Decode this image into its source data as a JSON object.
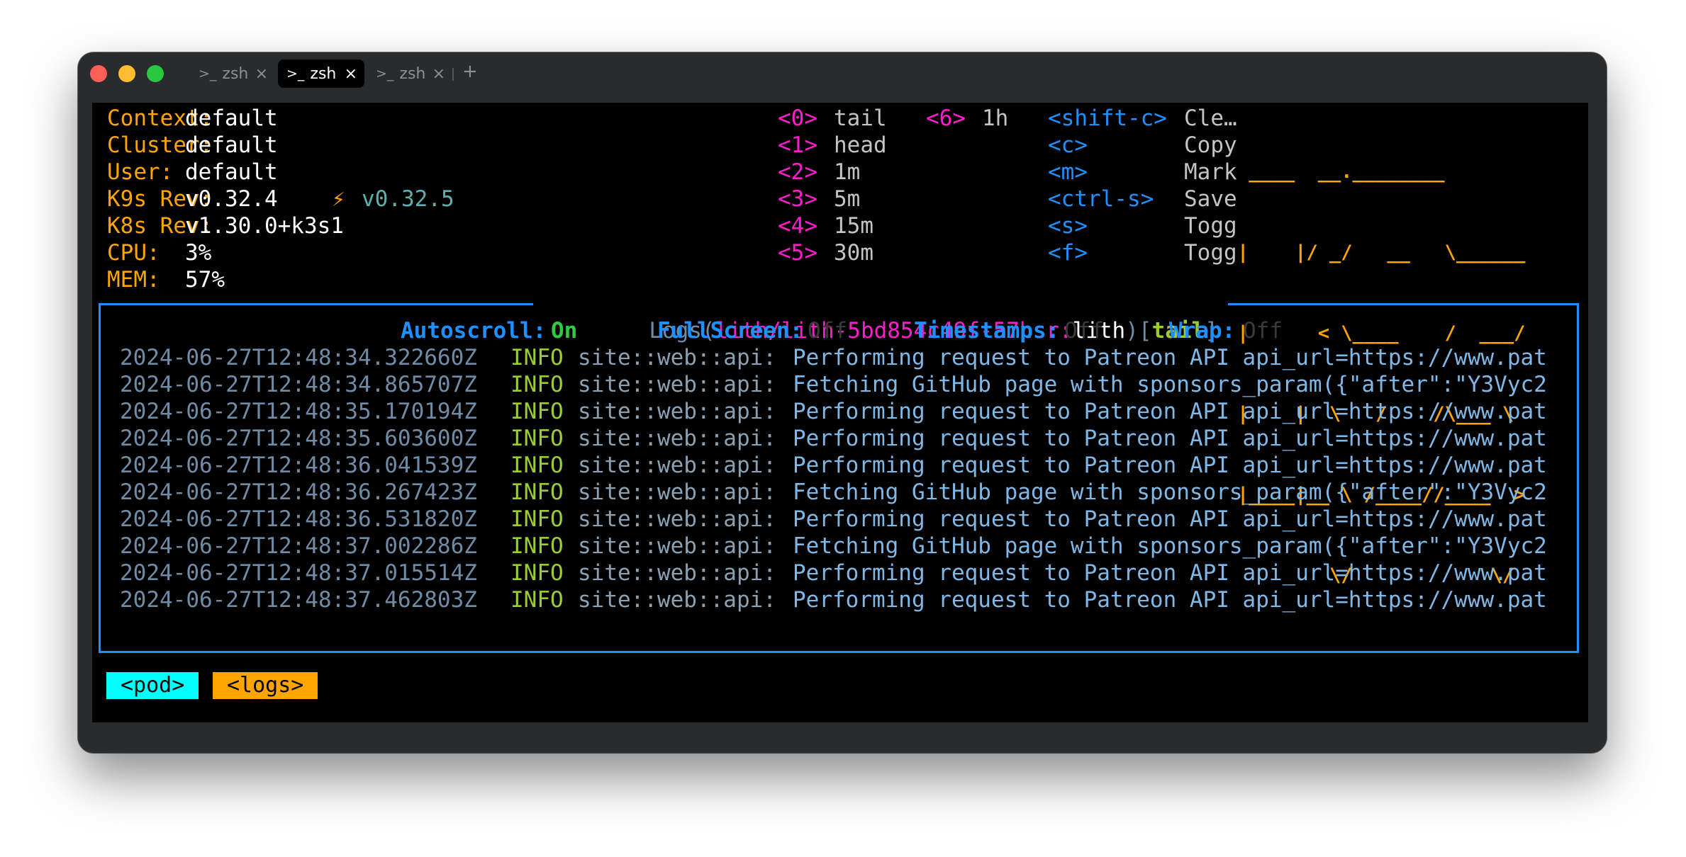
{
  "window": {
    "tabs": [
      {
        "prompt": ">_",
        "label": "zsh",
        "close": "×",
        "active": false
      },
      {
        "prompt": ">_",
        "label": "zsh",
        "close": "×",
        "active": true
      },
      {
        "prompt": ">_",
        "label": "zsh",
        "close": "×",
        "active": false
      }
    ],
    "new_tab": "+"
  },
  "info": [
    {
      "label": "Context:",
      "value": "default"
    },
    {
      "label": "Cluster:",
      "value": "default"
    },
    {
      "label": "User:",
      "value": "default"
    },
    {
      "label": "K9s Rev:",
      "value": "v0.32.4",
      "bolt": "⚡",
      "upgrade": "v0.32.5"
    },
    {
      "label": "K8s Rev:",
      "value": "v1.30.0+k3s1"
    },
    {
      "label": "CPU:",
      "value": "3%"
    },
    {
      "label": "MEM:",
      "value": "57%"
    }
  ],
  "menu_col1": [
    {
      "key": "<0>",
      "action": "tail"
    },
    {
      "key": "<1>",
      "action": "head"
    },
    {
      "key": "<2>",
      "action": "1m"
    },
    {
      "key": "<3>",
      "action": "5m"
    },
    {
      "key": "<4>",
      "action": "15m"
    },
    {
      "key": "<5>",
      "action": "30m"
    }
  ],
  "menu_col2": [
    {
      "key": "<6>",
      "action": "1h"
    }
  ],
  "menu_col3": [
    {
      "key": "<shift-c>",
      "action": "Cle…"
    },
    {
      "key": "<c>",
      "action": "Copy"
    },
    {
      "key": "<m>",
      "action": "Mark"
    },
    {
      "key": "<ctrl-s>",
      "action": "Save"
    },
    {
      "key": "<s>",
      "action": "Togg"
    },
    {
      "key": "<f>",
      "action": "Togg"
    }
  ],
  "logo": [
    " ____  __.________       ",
    "|    |/ _/   __   \\______",
    "|      < \\____    /  ___/",
    "|    |  \\   /    /\\___ \\ ",
    "|____|__ \\ /____//____  >",
    "        \\/            \\/ "
  ],
  "logs": {
    "title_prefix": "Logs(",
    "pod": "lith/lith-5bd854c49f-57hsr:",
    "container": "lith",
    "close_paren": ")",
    "mode_open": "[",
    "mode": "tail",
    "mode_close": "]",
    "status": [
      {
        "label": "Autoscroll:",
        "value": "On",
        "on": true
      },
      {
        "label": "FullScreen:",
        "value": "Off",
        "on": false
      },
      {
        "label": "Timestamps:",
        "value": "Off",
        "on": false
      },
      {
        "label": "Wrap:",
        "value": "Off",
        "on": false
      }
    ],
    "lines": [
      {
        "ts": "2024-06-27T12:48:34.322660Z",
        "level": "INFO",
        "target": "site::web::api:",
        "msg": "Performing request to Patreon API api_url=https://www.pat"
      },
      {
        "ts": "2024-06-27T12:48:34.865707Z",
        "level": "INFO",
        "target": "site::web::api:",
        "msg": "Fetching GitHub page with sponsors_param({\"after\":\"Y3Vyc2"
      },
      {
        "ts": "2024-06-27T12:48:35.170194Z",
        "level": "INFO",
        "target": "site::web::api:",
        "msg": "Performing request to Patreon API api_url=https://www.pat"
      },
      {
        "ts": "2024-06-27T12:48:35.603600Z",
        "level": "INFO",
        "target": "site::web::api:",
        "msg": "Performing request to Patreon API api_url=https://www.pat"
      },
      {
        "ts": "2024-06-27T12:48:36.041539Z",
        "level": "INFO",
        "target": "site::web::api:",
        "msg": "Performing request to Patreon API api_url=https://www.pat"
      },
      {
        "ts": "2024-06-27T12:48:36.267423Z",
        "level": "INFO",
        "target": "site::web::api:",
        "msg": "Fetching GitHub page with sponsors_param({\"after\":\"Y3Vyc2"
      },
      {
        "ts": "2024-06-27T12:48:36.531820Z",
        "level": "INFO",
        "target": "site::web::api:",
        "msg": "Performing request to Patreon API api_url=https://www.pat"
      },
      {
        "ts": "2024-06-27T12:48:37.002286Z",
        "level": "INFO",
        "target": "site::web::api:",
        "msg": "Fetching GitHub page with sponsors_param({\"after\":\"Y3Vyc2"
      },
      {
        "ts": "2024-06-27T12:48:37.015514Z",
        "level": "INFO",
        "target": "site::web::api:",
        "msg": "Performing request to Patreon API api_url=https://www.pat"
      },
      {
        "ts": "2024-06-27T12:48:37.462803Z",
        "level": "INFO",
        "target": "site::web::api:",
        "msg": "Performing request to Patreon API api_url=https://www.pat"
      }
    ]
  },
  "crumbs": [
    "<pod>",
    "<logs>"
  ]
}
